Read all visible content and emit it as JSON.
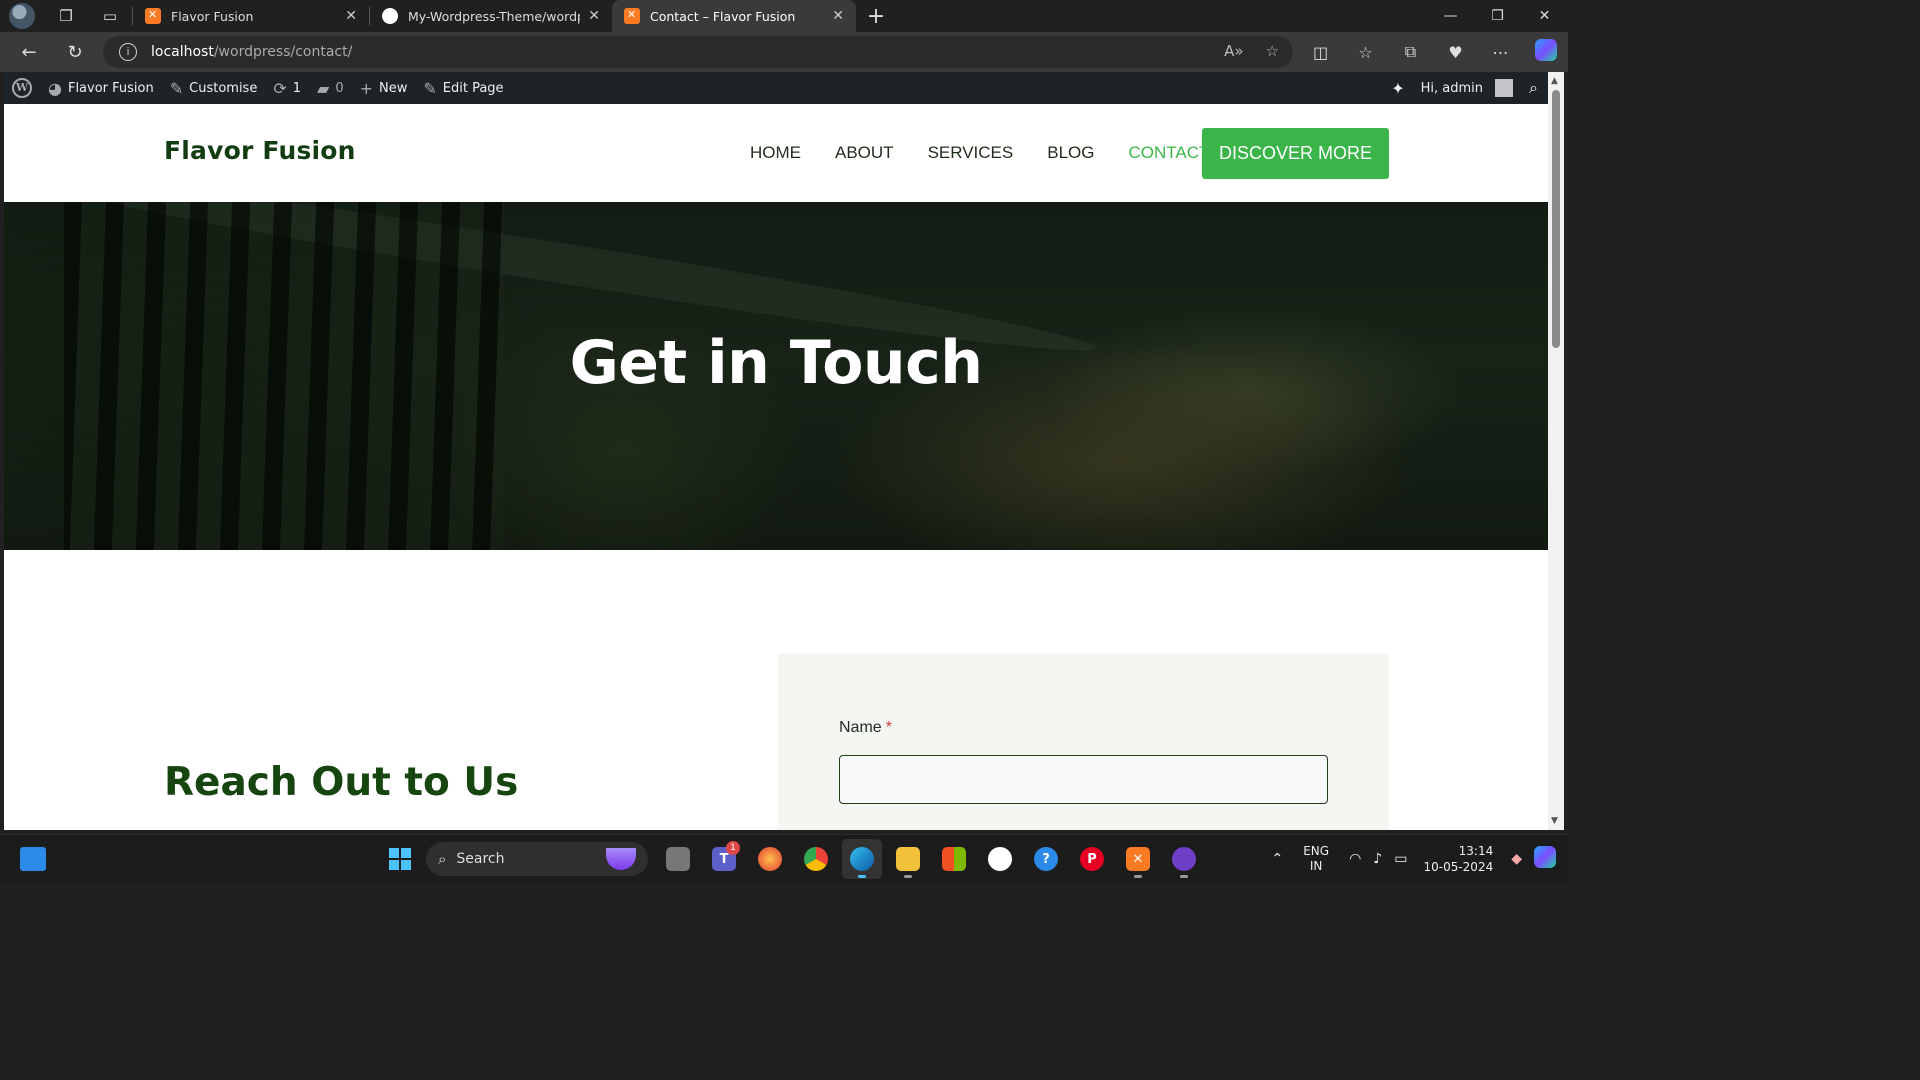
{
  "browser": {
    "tabs": [
      {
        "title": "Flavor Fusion",
        "icon": "xampp-icon",
        "active": false
      },
      {
        "title": "My-Wordpress-Theme/wordpres",
        "icon": "github-icon",
        "active": false
      },
      {
        "title": "Contact – Flavor Fusion",
        "icon": "xampp-icon",
        "active": true
      }
    ],
    "url_host": "localhost",
    "url_path": "/wordpress/contact/"
  },
  "admin_bar": {
    "site_name": "Flavor Fusion",
    "customise": "Customise",
    "updates_count": "1",
    "comments_count": "0",
    "new_label": "New",
    "edit_page": "Edit Page",
    "greeting": "Hi, admin"
  },
  "site": {
    "title": "Flavor Fusion",
    "menu": [
      {
        "label": "HOME",
        "current": false
      },
      {
        "label": "ABOUT",
        "current": false
      },
      {
        "label": "SERVICES",
        "current": false
      },
      {
        "label": "BLOG",
        "current": false
      },
      {
        "label": "CONTACT",
        "current": true
      }
    ],
    "cta_label": "DISCOVER MORE",
    "accent_color": "#3bb54a",
    "brand_color": "#123c11"
  },
  "hero": {
    "title": "Get in Touch"
  },
  "contact": {
    "heading": "Reach Out to Us",
    "name_label": "Name",
    "required_mark": "*"
  },
  "taskbar": {
    "search_label": "Search",
    "teams_badge": "1",
    "lang_line1": "ENG",
    "lang_line2": "IN",
    "time": "13:14",
    "date": "10-05-2024"
  }
}
